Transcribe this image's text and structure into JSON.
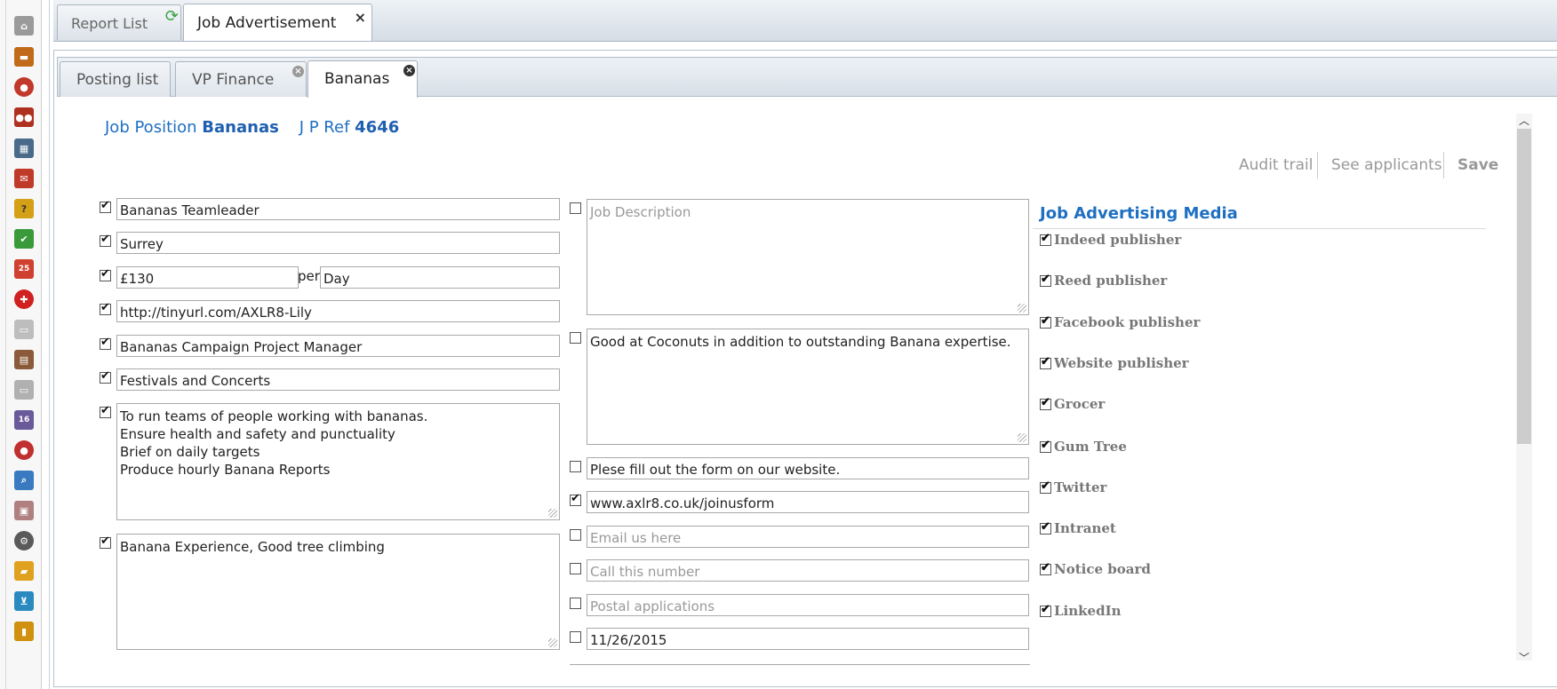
{
  "sidebar": {
    "items": [
      {
        "name": "bank-icon",
        "color": "#8a8a8a",
        "glyph": "🏛"
      },
      {
        "name": "briefcase-icon",
        "color": "#c06a1a",
        "glyph": "💼"
      },
      {
        "name": "user-icon",
        "color": "#c0392b",
        "glyph": "👤"
      },
      {
        "name": "users-group-icon",
        "color": "#b03020",
        "glyph": "👥"
      },
      {
        "name": "layout-icon",
        "color": "#4a6a8a",
        "glyph": "▦"
      },
      {
        "name": "mail-icon",
        "color": "#c03a2a",
        "glyph": "✉"
      },
      {
        "name": "ticket-icon",
        "color": "#d4a017",
        "glyph": "?"
      },
      {
        "name": "checklist-icon",
        "color": "#3a9a3a",
        "glyph": "✔"
      },
      {
        "name": "calendar-icon",
        "color": "#d04030",
        "glyph": "25"
      },
      {
        "name": "medical-cross-icon",
        "color": "#d02020",
        "glyph": "✚"
      },
      {
        "name": "folder-grey-icon",
        "color": "#a0a0a0",
        "glyph": "▭"
      },
      {
        "name": "book-icon",
        "color": "#8a5a3a",
        "glyph": "▤"
      },
      {
        "name": "folder-icon",
        "color": "#9a9a9a",
        "glyph": "▭"
      },
      {
        "name": "calendar-16-icon",
        "color": "#6a5a9a",
        "glyph": "16"
      },
      {
        "name": "user-admin-icon",
        "color": "#c03030",
        "glyph": "👤"
      },
      {
        "name": "search-icon",
        "color": "#3a7ac0",
        "glyph": "⌕"
      },
      {
        "name": "id-card-icon",
        "color": "#b08080",
        "glyph": "▣"
      },
      {
        "name": "gear-icon",
        "color": "#5a5a5a",
        "glyph": "⚙"
      },
      {
        "name": "open-folder-icon",
        "color": "#e0a020",
        "glyph": "▰"
      },
      {
        "name": "cart-icon",
        "color": "#2a8ac0",
        "glyph": "🛒"
      },
      {
        "name": "lock-icon",
        "color": "#d09010",
        "glyph": "🔒"
      }
    ]
  },
  "top_tabs": {
    "report_list": "Report List",
    "job_advertisement": "Job Advertisement",
    "close": "×"
  },
  "sub_tabs": {
    "posting_list": "Posting list",
    "vp_finance": "VP Finance",
    "bananas": "Bananas",
    "close": "×"
  },
  "header": {
    "job_position_label": "Job Position",
    "job_position_value": "Bananas",
    "ref_label": "J P Ref",
    "ref_value": "4646"
  },
  "actions": {
    "audit_trail": "Audit trail",
    "see_applicants": "See applicants",
    "save": "Save"
  },
  "left_fields": {
    "title": "Bananas Teamleader",
    "location": "Surrey",
    "salary": "£130",
    "per_label": "per",
    "period": "Day",
    "url": "http://tinyurl.com/AXLR8-Lily",
    "reports_to": "Bananas Campaign Project Manager",
    "department": "Festivals and Concerts",
    "responsibilities": [
      "To run teams of people working with bananas.",
      "Ensure health and safety and punctuality",
      "Brief on daily targets",
      "Produce hourly Banana Reports"
    ],
    "experience": "Banana Experience, Good tree climbing"
  },
  "middle_fields": {
    "job_description_placeholder": "Job Description",
    "requirements": "Good at Coconuts in addition to outstanding Banana expertise.",
    "apply_instructions": "Plese fill out the form on our website.",
    "apply_url": "www.axlr8.co.uk/joinusform",
    "email_placeholder": "Email us here",
    "phone_placeholder": "Call this number",
    "postal_placeholder": "Postal applications",
    "closing_date": "11/26/2015"
  },
  "media": {
    "title": "Job Advertising Media",
    "items": [
      "Indeed publisher",
      "Reed publisher",
      "Facebook publisher",
      "Website publisher",
      "Grocer",
      "Gum Tree",
      "Twitter",
      "Intranet",
      "Notice board",
      "LinkedIn"
    ]
  }
}
